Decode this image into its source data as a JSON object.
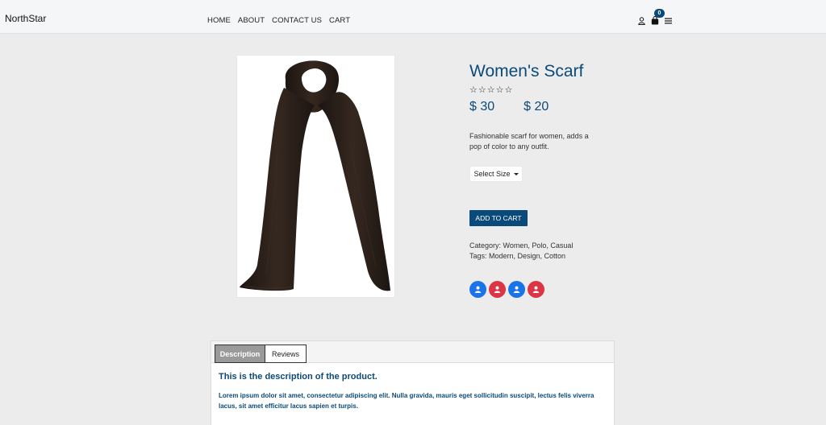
{
  "navbar": {
    "brand": "NorthStar",
    "links": [
      "HOME",
      "ABOUT",
      "CONTACT US",
      "CART"
    ],
    "icons": [
      "user-icon",
      "shopping-bag-icon",
      "menu-icon"
    ],
    "cart_count": "0"
  },
  "product": {
    "title": "Women's Scarf",
    "rating_stars": [
      "☆",
      "☆",
      "☆",
      "☆",
      "☆"
    ],
    "price_old": "$ 30",
    "price_new": "$ 20",
    "short_description": "Fashionable scarf for women, adds a pop of color to any outfit.",
    "size_select": "Select Size",
    "add_to_cart": "ADD TO CART",
    "category": "Category: Women, Polo, Casual",
    "tags": "Tags: Modern, Design, Cotton"
  },
  "social_avatars": [
    {
      "icon": "user-icon",
      "color": "#1a73e8"
    },
    {
      "icon": "user-icon",
      "color": "#dc3545"
    },
    {
      "icon": "user-icon",
      "color": "#1a73e8"
    },
    {
      "icon": "user-icon",
      "color": "#dc3545"
    }
  ],
  "tabs": {
    "items": [
      "Description",
      "Reviews"
    ],
    "active": "Description",
    "description_title": "This is the description of the product.",
    "description_body": "Lorem ipsum dolor sit amet, consectetur adipiscing elit. Nulla gravida, mauris eget sollicitudin suscipit, lectus felis viverra lacus, sit amet efficitur lacus sapien et turpis."
  },
  "colors": {
    "accent": "#0a4a7a",
    "background": "#ececec",
    "scarf": "#2a1f1a"
  }
}
